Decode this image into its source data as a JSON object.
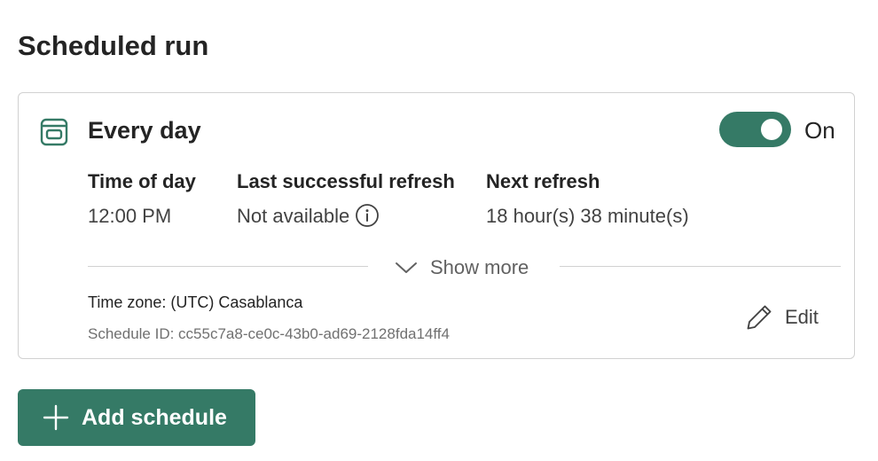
{
  "page": {
    "title": "Scheduled run"
  },
  "schedule": {
    "name": "Every day",
    "toggle_state": "On",
    "columns": [
      {
        "header": "Time of day",
        "value": "12:00 PM"
      },
      {
        "header": "Last successful refresh",
        "value": "Not available"
      },
      {
        "header": "Next refresh",
        "value": "18 hour(s) 38 minute(s)"
      }
    ],
    "show_more_label": "Show more",
    "timezone": "Time zone: (UTC) Casablanca",
    "schedule_id": "Schedule ID: cc55c7a8-ce0c-43b0-ad69-2128fda14ff4",
    "edit_label": "Edit"
  },
  "actions": {
    "add_schedule_label": "Add schedule"
  },
  "colors": {
    "accent": "#357a66",
    "border": "#d1d1d1",
    "muted_text": "#707070"
  },
  "icons": {
    "schedule": "calendar-icon",
    "info": "info-icon",
    "expand": "chevron-down-icon",
    "edit": "pencil-icon",
    "add": "plus-icon"
  }
}
